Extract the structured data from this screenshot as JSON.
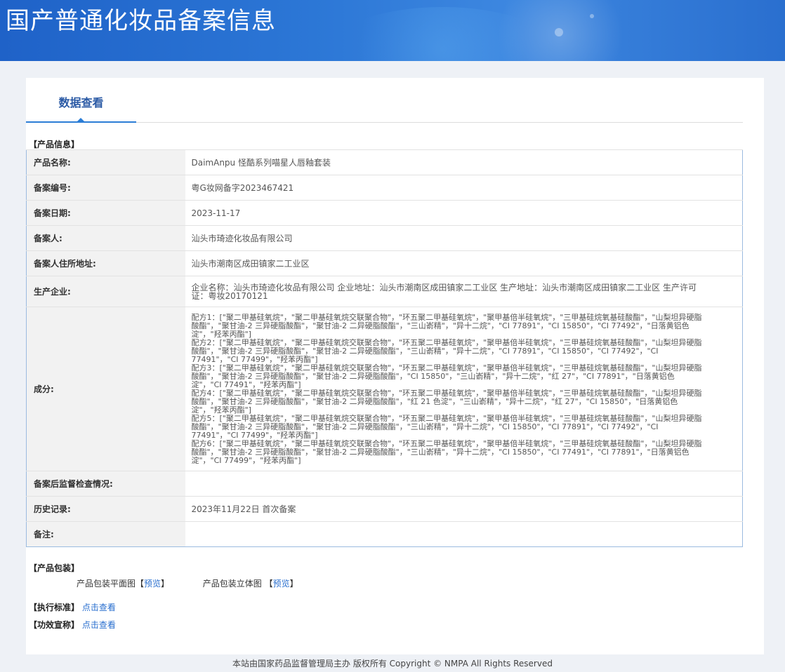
{
  "header": {
    "title": "国产普通化妆品备案信息"
  },
  "tabs": {
    "active": "数据查看"
  },
  "product_info": {
    "section_title": "【产品信息】",
    "rows": [
      {
        "label": "产品名称:",
        "value": "DaimAnpu 怪酷系列喵星人唇釉套装"
      },
      {
        "label": "备案编号:",
        "value": "粤G妆网备字2023467421"
      },
      {
        "label": "备案日期:",
        "value": "2023-11-17"
      },
      {
        "label": "备案人:",
        "value": "汕头市琦迹化妆品有限公司"
      },
      {
        "label": "备案人住所地址:",
        "value": "汕头市潮南区成田镇家二工业区"
      },
      {
        "label": "生产企业:",
        "value": "企业名称：汕头市琦迹化妆品有限公司 企业地址：汕头市潮南区成田镇家二工业区 生产地址：汕头市潮南区成田镇家二工业区 生产许可证：粤妆20170121"
      },
      {
        "label": "成分:",
        "value": "配方1：[\"聚二甲基硅氧烷\"，\"聚二甲基硅氧烷交联聚合物\"，\"环五聚二甲基硅氧烷\"，\"聚甲基倍半硅氧烷\"，\"三甲基硅烷氧基硅酸酯\"，\"山梨坦异硬脂酸酯\"，\"聚甘油-2 三异硬脂酸酯\"，\"聚甘油-2 二异硬脂酸酯\"，\"三山嵛精\"，\"异十二烷\"，\"CI 77891\"，\"CI 15850\"，\"CI 77492\"，\"日落黄铝色淀\"，\"羟苯丙酯\"]\n配方2：[\"聚二甲基硅氧烷\"，\"聚二甲基硅氧烷交联聚合物\"，\"环五聚二甲基硅氧烷\"，\"聚甲基倍半硅氧烷\"，\"三甲基硅烷氧基硅酸酯\"，\"山梨坦异硬脂酸酯\"，\"聚甘油-2 三异硬脂酸酯\"，\"聚甘油-2 二异硬脂酸酯\"，\"三山嵛精\"，\"异十二烷\"，\"CI 77891\"，\"CI 15850\"，\"CI 77492\"，\"CI 77491\"，\"CI 77499\"，\"羟苯丙酯\"]\n配方3：[\"聚二甲基硅氧烷\"，\"聚二甲基硅氧烷交联聚合物\"，\"环五聚二甲基硅氧烷\"，\"聚甲基倍半硅氧烷\"，\"三甲基硅烷氧基硅酸酯\"，\"山梨坦异硬脂酸酯\"，\"聚甘油-2 三异硬脂酸酯\"，\"聚甘油-2 二异硬脂酸酯\"，\"CI 15850\"，\"三山嵛精\"，\"异十二烷\"，\"红 27\"，\"CI 77891\"，\"日落黄铝色淀\"，\"CI 77491\"，\"羟苯丙酯\"]\n配方4：[\"聚二甲基硅氧烷\"，\"聚二甲基硅氧烷交联聚合物\"，\"环五聚二甲基硅氧烷\"，\"聚甲基倍半硅氧烷\"，\"三甲基硅烷氧基硅酸酯\"，\"山梨坦异硬脂酸酯\"，\"聚甘油-2 三异硬脂酸酯\"，\"聚甘油-2 二异硬脂酸酯\"，\"红 21 色淀\"，\"三山嵛精\"，\"异十二烷\"，\"红 27\"，\"CI 15850\"，\"日落黄铝色淀\"，\"羟苯丙酯\"]\n配方5：[\"聚二甲基硅氧烷\"，\"聚二甲基硅氧烷交联聚合物\"，\"环五聚二甲基硅氧烷\"，\"聚甲基倍半硅氧烷\"，\"三甲基硅烷氧基硅酸酯\"，\"山梨坦异硬脂酸酯\"，\"聚甘油-2 三异硬脂酸酯\"，\"聚甘油-2 二异硬脂酸酯\"，\"三山嵛精\"，\"异十二烷\"，\"CI 15850\"，\"CI 77891\"，\"CI 77492\"，\"CI 77491\"，\"CI 77499\"，\"羟苯丙酯\"]\n配方6：[\"聚二甲基硅氧烷\"，\"聚二甲基硅氧烷交联聚合物\"，\"环五聚二甲基硅氧烷\"，\"聚甲基倍半硅氧烷\"，\"三甲基硅烷氧基硅酸酯\"，\"山梨坦异硬脂酸酯\"，\"聚甘油-2 三异硬脂酸酯\"，\"聚甘油-2 二异硬脂酸酯\"，\"三山嵛精\"，\"异十二烷\"，\"CI 15850\"，\"CI 77491\"，\"CI 77891\"，\"日落黄铝色淀\"，\"CI 77499\"，\"羟苯丙酯\"]"
      },
      {
        "label": "备案后监督检查情况:",
        "value": ""
      },
      {
        "label": "历史记录:",
        "value": "2023年11月22日 首次备案"
      },
      {
        "label": "备注:",
        "value": ""
      }
    ]
  },
  "packaging": {
    "section_title": "【产品包装】",
    "flat_label": "产品包装平面图",
    "flat_link": "预览",
    "stereo_label": "产品包装立体图",
    "stereo_link": "预览",
    "bracket_open": "【",
    "bracket_close": "】"
  },
  "standard": {
    "label": "【执行标准】",
    "link": "点击查看"
  },
  "efficacy": {
    "label": "【功效宣称】",
    "link": "点击查看"
  },
  "footer": {
    "text": "本站由国家药品监督管理局主办 版权所有 Copyright © NMPA All Rights Reserved"
  }
}
